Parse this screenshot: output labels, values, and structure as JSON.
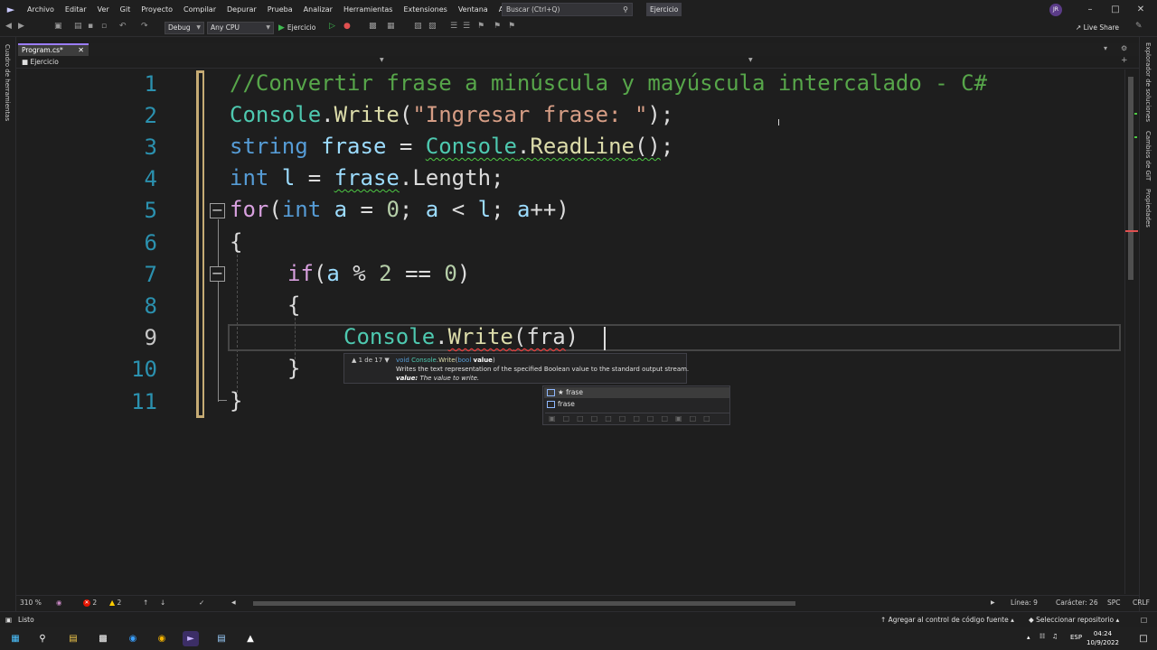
{
  "menubar": {
    "items": [
      "Archivo",
      "Editar",
      "Ver",
      "Git",
      "Proyecto",
      "Compilar",
      "Depurar",
      "Prueba",
      "Analizar",
      "Herramientas",
      "Extensiones",
      "Ventana",
      "Ayuda"
    ],
    "search_placeholder": "Buscar (Ctrl+Q)",
    "solution_name": "Ejercicio",
    "avatar_initials": "JR"
  },
  "toolbar": {
    "configuration": "Debug",
    "platform": "Any CPU",
    "run_label": "Ejercicio",
    "live_share": "Live Share"
  },
  "left_strip": {
    "label": "Cuadro de herramientas"
  },
  "right_strip": {
    "tabs": [
      "Explorador de soluciones",
      "Cambios de GIT",
      "Propiedades"
    ]
  },
  "tab": {
    "title": "Program.cs*"
  },
  "navbar": {
    "project": "Ejercicio"
  },
  "editor": {
    "line_numbers": [
      "1",
      "2",
      "3",
      "4",
      "5",
      "6",
      "7",
      "8",
      "9",
      "10",
      "11"
    ],
    "current_line": 9,
    "lines": [
      [
        {
          "t": "//Convertir frase a minúscula y mayúscula intercalado - C#",
          "c": "cmt"
        }
      ],
      [
        {
          "t": "Console",
          "c": "cls"
        },
        {
          "t": ".",
          "c": "pl"
        },
        {
          "t": "Write",
          "c": "mth"
        },
        {
          "t": "(",
          "c": "pl"
        },
        {
          "t": "\"Ingresar frase: \"",
          "c": "str"
        },
        {
          "t": ");",
          "c": "pl"
        }
      ],
      [
        {
          "t": "string",
          "c": "kw"
        },
        {
          "t": " ",
          "c": "pl"
        },
        {
          "t": "frase",
          "c": "var"
        },
        {
          "t": " = ",
          "c": "pl"
        },
        {
          "t": "Console",
          "c": "cls squig-green"
        },
        {
          "t": ".",
          "c": "pl squig-green"
        },
        {
          "t": "ReadLine",
          "c": "mth squig-green"
        },
        {
          "t": "()",
          "c": "pl squig-green"
        },
        {
          "t": ";",
          "c": "pl"
        }
      ],
      [
        {
          "t": "int",
          "c": "kw"
        },
        {
          "t": " ",
          "c": "pl"
        },
        {
          "t": "l",
          "c": "var"
        },
        {
          "t": " = ",
          "c": "pl"
        },
        {
          "t": "frase",
          "c": "var squig-green"
        },
        {
          "t": ".",
          "c": "pl"
        },
        {
          "t": "Length",
          "c": "pl"
        },
        {
          "t": ";",
          "c": "pl"
        }
      ],
      [
        {
          "t": "for",
          "c": "ctl"
        },
        {
          "t": "(",
          "c": "pl"
        },
        {
          "t": "int",
          "c": "kw"
        },
        {
          "t": " ",
          "c": "pl"
        },
        {
          "t": "a",
          "c": "var"
        },
        {
          "t": " = ",
          "c": "pl"
        },
        {
          "t": "0",
          "c": "num"
        },
        {
          "t": "; ",
          "c": "pl"
        },
        {
          "t": "a",
          "c": "var"
        },
        {
          "t": " < ",
          "c": "pl"
        },
        {
          "t": "l",
          "c": "var"
        },
        {
          "t": "; ",
          "c": "pl"
        },
        {
          "t": "a",
          "c": "var"
        },
        {
          "t": "++)",
          "c": "pl"
        }
      ],
      [
        {
          "t": "{",
          "c": "pl"
        }
      ],
      [
        {
          "t": "if",
          "c": "ctl"
        },
        {
          "t": "(",
          "c": "pl"
        },
        {
          "t": "a",
          "c": "var"
        },
        {
          "t": " % ",
          "c": "pl"
        },
        {
          "t": "2",
          "c": "num"
        },
        {
          "t": " == ",
          "c": "pl"
        },
        {
          "t": "0",
          "c": "num"
        },
        {
          "t": ")",
          "c": "pl"
        }
      ],
      [
        {
          "t": "{",
          "c": "pl"
        }
      ],
      [
        {
          "t": "Console",
          "c": "cls"
        },
        {
          "t": ".",
          "c": "pl"
        },
        {
          "t": "Write",
          "c": "mth squig-red"
        },
        {
          "t": "(",
          "c": "pl squig-red"
        },
        {
          "t": "fra",
          "c": "pl squig-red"
        },
        {
          "t": ")",
          "c": "pl"
        }
      ],
      [
        {
          "t": "}",
          "c": "pl"
        }
      ],
      [
        {
          "t": "}",
          "c": "pl"
        }
      ]
    ]
  },
  "param_info": {
    "counter": "1 de 17",
    "return_type": "void",
    "class_name": "Console",
    "method_name": "Write",
    "param_type": "bool",
    "param_name": "value",
    "description": "Writes the text representation of the specified Boolean value to the standard output stream.",
    "value_label": "value:",
    "value_description": "The value to write."
  },
  "completion": {
    "items": [
      {
        "label": "★ frase",
        "selected": true
      },
      {
        "label": "frase",
        "selected": false
      }
    ]
  },
  "editor_status": {
    "zoom": "310 %",
    "errors": "2",
    "warnings": "2",
    "line": "Línea: 9",
    "column": "Carácter: 26",
    "whitespace": "SPC",
    "line_ending": "CRLF"
  },
  "statusbar": {
    "ready": "Listo",
    "add_source_control": "Agregar al control de código fuente",
    "select_repo": "Seleccionar repositorio"
  },
  "taskbar": {
    "language": "ESP",
    "time": "04:24",
    "date": "10/9/2022"
  }
}
